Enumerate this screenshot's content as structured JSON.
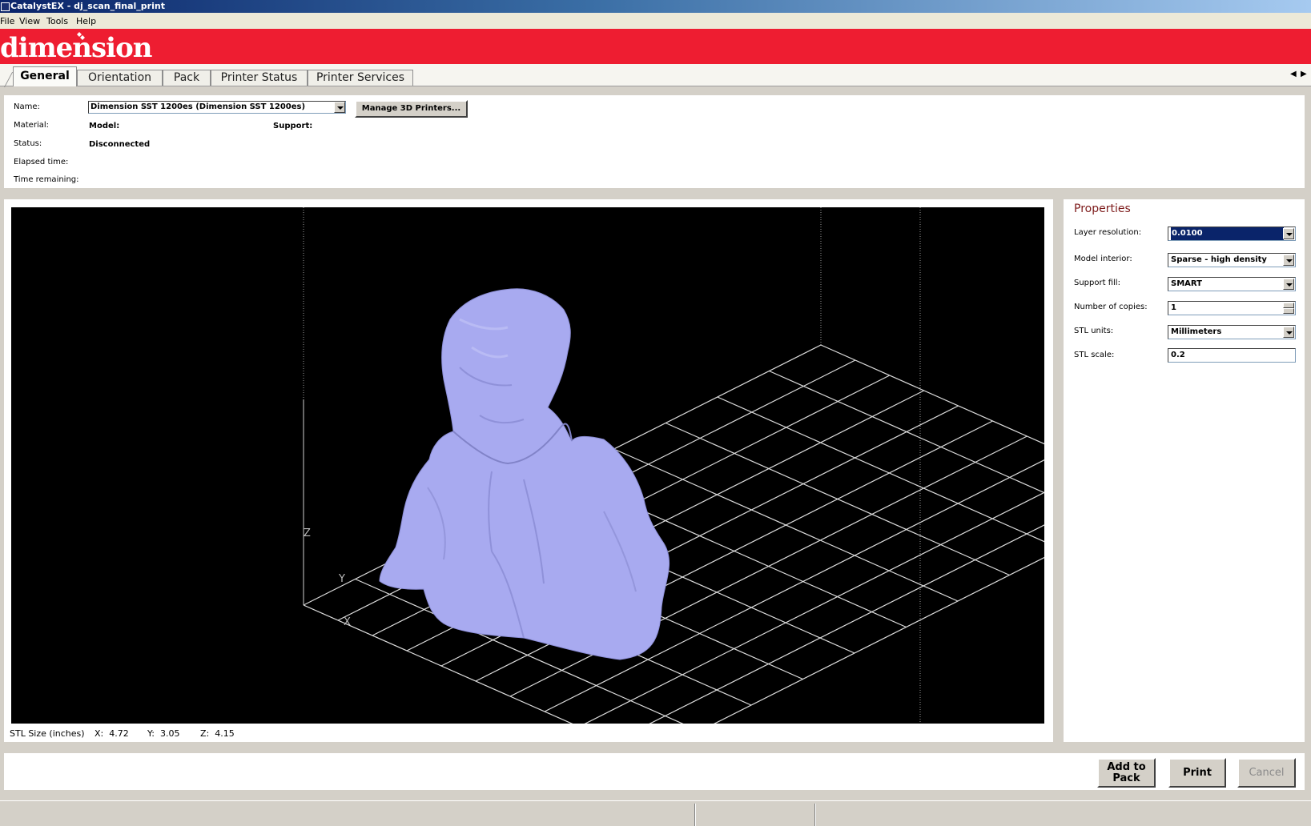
{
  "window": {
    "title": "CatalystEX - dj_scan_final_print"
  },
  "menu": [
    "File",
    "View",
    "Tools",
    "Help"
  ],
  "brand": {
    "logo_text": "dimension"
  },
  "tabs": [
    "General",
    "Orientation",
    "Pack",
    "Printer Status",
    "Printer Services"
  ],
  "active_tab": "General",
  "printer": {
    "name_label": "Name:",
    "name_value": "Dimension SST 1200es  (Dimension SST 1200es)",
    "manage_button": "Manage 3D Printers...",
    "material_label": "Material:",
    "model_label": "Model:",
    "support_label": "Support:",
    "status_label": "Status:",
    "status_value": "Disconnected",
    "elapsed_label": "Elapsed time:",
    "remaining_label": "Time remaining:"
  },
  "viewport": {
    "axis_z": "Z",
    "axis_y": "Y",
    "axis_x": "X",
    "model_color": "#a8aaf0",
    "grid_color": "#e8e8e8"
  },
  "stl_size": {
    "label": "STL Size (inches)",
    "x": "X:  4.72",
    "y": "Y:  3.05",
    "z": "Z:  4.15"
  },
  "properties": {
    "title": "Properties",
    "layer_resolution_label": "Layer resolution:",
    "layer_resolution_value": "0.0100",
    "model_interior_label": "Model interior:",
    "model_interior_value": "Sparse - high density",
    "support_fill_label": "Support fill:",
    "support_fill_value": "SMART",
    "copies_label": "Number of copies:",
    "copies_value": "1",
    "stl_units_label": "STL units:",
    "stl_units_value": "Millimeters",
    "stl_scale_label": "STL scale:",
    "stl_scale_value": "0.2"
  },
  "actions": {
    "add_to_pack": "Add to Pack",
    "print": "Print",
    "cancel": "Cancel"
  },
  "colors": {
    "brand_red": "#ee1d31",
    "properties_title": "#7d1b1b",
    "selection": "#0a246a"
  }
}
